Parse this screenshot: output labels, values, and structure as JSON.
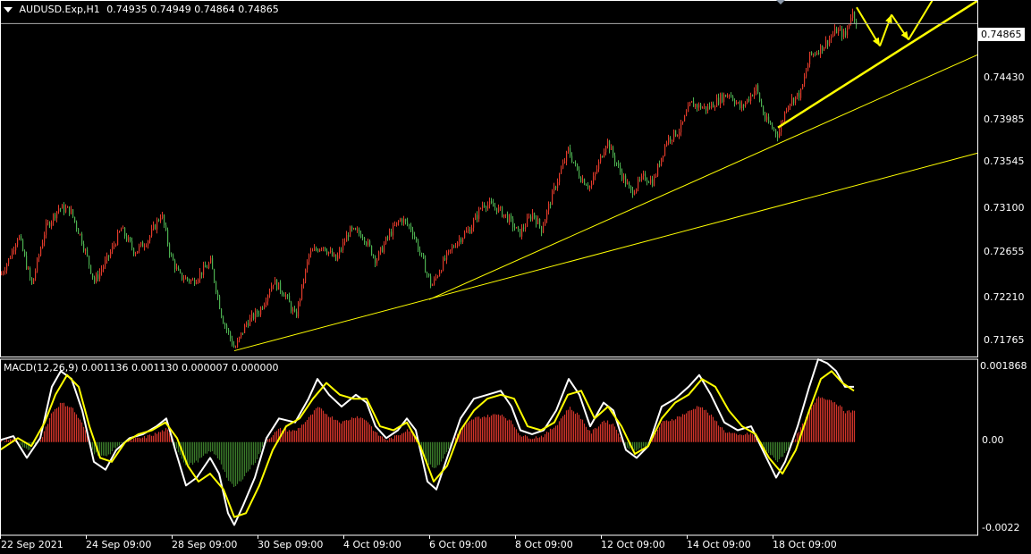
{
  "header": {
    "symbol_text": "AUDUSD.Exp,H1",
    "ohlc_text": "0.74935 0.74949 0.74864 0.74865",
    "menu_icon": "triangle-down-icon"
  },
  "colors": {
    "background": "#000000",
    "bull": "#e03a2a",
    "bear": "#4caf50",
    "trendline": "#ffff00",
    "macd_line": "#ffffff",
    "signal_line": "#ffff00",
    "hist_pos": "#d0342a",
    "hist_neg": "#3a7a2a",
    "grid_line": "#aaaaaa"
  },
  "chart_data": [
    {
      "type": "candlestick",
      "title": "AUDUSD.Exp,H1",
      "current_price_label": "0.74865",
      "ylim": [
        0.7168,
        0.7509
      ],
      "y_ticks": [
        "0.74430",
        "0.73985",
        "0.73545",
        "0.73100",
        "0.72655",
        "0.72210",
        "0.71765"
      ],
      "x_ticks": [
        "22 Sep 2021",
        "24 Sep 09:00",
        "28 Sep 09:00",
        "30 Sep 09:00",
        "4 Oct 09:00",
        "6 Oct 09:00",
        "8 Oct 09:00",
        "12 Oct 09:00",
        "14 Oct 09:00",
        "18 Oct 09:00"
      ],
      "close_path": [
        [
          0,
          0.7246
        ],
        [
          10,
          0.7262
        ],
        [
          20,
          0.7285
        ],
        [
          35,
          0.7236
        ],
        [
          50,
          0.729
        ],
        [
          65,
          0.731
        ],
        [
          78,
          0.7308
        ],
        [
          90,
          0.7282
        ],
        [
          105,
          0.724
        ],
        [
          120,
          0.7262
        ],
        [
          135,
          0.729
        ],
        [
          150,
          0.7268
        ],
        [
          165,
          0.728
        ],
        [
          180,
          0.7305
        ],
        [
          190,
          0.7265
        ],
        [
          200,
          0.7245
        ],
        [
          215,
          0.724
        ],
        [
          235,
          0.7258
        ],
        [
          248,
          0.7205
        ],
        [
          262,
          0.7175
        ],
        [
          275,
          0.72
        ],
        [
          290,
          0.7212
        ],
        [
          305,
          0.724
        ],
        [
          318,
          0.7228
        ],
        [
          330,
          0.7205
        ],
        [
          345,
          0.7265
        ],
        [
          360,
          0.7275
        ],
        [
          375,
          0.726
        ],
        [
          390,
          0.7288
        ],
        [
          405,
          0.7285
        ],
        [
          420,
          0.726
        ],
        [
          435,
          0.7285
        ],
        [
          448,
          0.73
        ],
        [
          460,
          0.729
        ],
        [
          470,
          0.7265
        ],
        [
          482,
          0.7235
        ],
        [
          495,
          0.7258
        ],
        [
          510,
          0.7278
        ],
        [
          525,
          0.729
        ],
        [
          540,
          0.7315
        ],
        [
          555,
          0.731
        ],
        [
          568,
          0.73
        ],
        [
          580,
          0.7285
        ],
        [
          595,
          0.7305
        ],
        [
          605,
          0.729
        ],
        [
          620,
          0.733
        ],
        [
          635,
          0.7365
        ],
        [
          648,
          0.734
        ],
        [
          660,
          0.733
        ],
        [
          678,
          0.7375
        ],
        [
          690,
          0.735
        ],
        [
          705,
          0.7325
        ],
        [
          720,
          0.734
        ],
        [
          730,
          0.7335
        ],
        [
          745,
          0.7375
        ],
        [
          760,
          0.7385
        ],
        [
          772,
          0.741
        ],
        [
          790,
          0.7405
        ],
        [
          805,
          0.7415
        ],
        [
          815,
          0.742
        ],
        [
          828,
          0.7405
        ],
        [
          845,
          0.7425
        ],
        [
          855,
          0.7395
        ],
        [
          870,
          0.738
        ],
        [
          880,
          0.741
        ],
        [
          895,
          0.742
        ],
        [
          905,
          0.7455
        ],
        [
          920,
          0.7465
        ],
        [
          935,
          0.748
        ],
        [
          945,
          0.7475
        ],
        [
          952,
          0.7498
        ],
        [
          958,
          0.7487
        ]
      ],
      "trendlines": [
        {
          "x1": 262,
          "y1": 0.71735,
          "x2": 1093,
          "y2": 0.73625,
          "width": 1
        },
        {
          "x1": 480,
          "y1": 0.72225,
          "x2": 1093,
          "y2": 0.74565,
          "width": 1
        },
        {
          "x1": 870,
          "y1": 0.7387,
          "x2": 1093,
          "y2": 0.75082,
          "width": 2.5
        }
      ],
      "projection_arrows": [
        {
          "x1": 958,
          "y1": 0.7502,
          "x2": 984,
          "y2": 0.7465
        },
        {
          "x1": 984,
          "y1": 0.7465,
          "x2": 997,
          "y2": 0.7495
        },
        {
          "x1": 997,
          "y1": 0.7495,
          "x2": 1016,
          "y2": 0.7471
        },
        {
          "x1": 1016,
          "y1": 0.7471,
          "x2": 1050,
          "y2": 0.7519
        }
      ]
    },
    {
      "type": "line",
      "title": "MACD(12,26,9) 0.001136 0.001130 0.000007 0.000000",
      "ylim": [
        -0.00236,
        0.0021
      ],
      "y_ticks": [
        "0.001868",
        "0.00",
        "-0.0022"
      ],
      "series": [
        {
          "name": "MACD",
          "points": [
            [
              0,
              5e-05
            ],
            [
              15,
              0.00015
            ],
            [
              30,
              -0.0004
            ],
            [
              45,
              0.0001
            ],
            [
              58,
              0.0014
            ],
            [
              68,
              0.0018
            ],
            [
              80,
              0.0016
            ],
            [
              92,
              0.0008
            ],
            [
              105,
              -0.0005
            ],
            [
              118,
              -0.0007
            ],
            [
              130,
              -0.0002
            ],
            [
              145,
              0.0001
            ],
            [
              160,
              0.0002
            ],
            [
              175,
              0.0004
            ],
            [
              186,
              0.0006
            ],
            [
              196,
              -0.0002
            ],
            [
              208,
              -0.0011
            ],
            [
              220,
              -0.0009
            ],
            [
              235,
              -0.0004
            ],
            [
              245,
              -0.0008
            ],
            [
              255,
              -0.0018
            ],
            [
              262,
              -0.0021
            ],
            [
              272,
              -0.0016
            ],
            [
              285,
              -0.0009
            ],
            [
              298,
              0.0001
            ],
            [
              312,
              0.0006
            ],
            [
              330,
              0.0005
            ],
            [
              345,
              0.0011
            ],
            [
              355,
              0.0016
            ],
            [
              368,
              0.0012
            ],
            [
              382,
              0.0009
            ],
            [
              398,
              0.0012
            ],
            [
              410,
              0.001
            ],
            [
              420,
              0.0004
            ],
            [
              432,
              0.0001
            ],
            [
              445,
              0.0003
            ],
            [
              455,
              0.0006
            ],
            [
              465,
              0.0003
            ],
            [
              478,
              -0.001
            ],
            [
              488,
              -0.0012
            ],
            [
              500,
              -0.0004
            ],
            [
              515,
              0.0006
            ],
            [
              530,
              0.0011
            ],
            [
              545,
              0.0012
            ],
            [
              560,
              0.0013
            ],
            [
              572,
              0.0009
            ],
            [
              582,
              0.0003
            ],
            [
              595,
              0.0002
            ],
            [
              608,
              0.0003
            ],
            [
              622,
              0.0008
            ],
            [
              636,
              0.0016
            ],
            [
              648,
              0.0012
            ],
            [
              660,
              0.0004
            ],
            [
              675,
              0.001
            ],
            [
              686,
              0.0008
            ],
            [
              700,
              -0.0002
            ],
            [
              712,
              -0.0004
            ],
            [
              725,
              -0.0001
            ],
            [
              740,
              0.0009
            ],
            [
              755,
              0.0011
            ],
            [
              770,
              0.0014
            ],
            [
              782,
              0.0017
            ],
            [
              795,
              0.0012
            ],
            [
              810,
              0.0005
            ],
            [
              825,
              0.0003
            ],
            [
              840,
              0.0004
            ],
            [
              855,
              -0.0003
            ],
            [
              868,
              -0.0009
            ],
            [
              878,
              -0.0005
            ],
            [
              892,
              0.0004
            ],
            [
              905,
              0.0014
            ],
            [
              915,
              0.0021
            ],
            [
              925,
              0.002
            ],
            [
              935,
              0.0018
            ],
            [
              945,
              0.0014
            ],
            [
              955,
              0.0014
            ]
          ]
        },
        {
          "name": "Signal",
          "points": [
            [
              0,
              -0.0002
            ],
            [
              20,
              0.0001
            ],
            [
              35,
              -0.0001
            ],
            [
              50,
              0.0005
            ],
            [
              62,
              0.0012
            ],
            [
              75,
              0.0017
            ],
            [
              88,
              0.0014
            ],
            [
              100,
              0.0004
            ],
            [
              112,
              -0.0004
            ],
            [
              125,
              -0.0005
            ],
            [
              140,
              0.0
            ],
            [
              155,
              0.0002
            ],
            [
              170,
              0.0003
            ],
            [
              185,
              0.0005
            ],
            [
              198,
              0.0001
            ],
            [
              210,
              -0.0006
            ],
            [
              222,
              -0.001
            ],
            [
              235,
              -0.0008
            ],
            [
              250,
              -0.0012
            ],
            [
              262,
              -0.0019
            ],
            [
              275,
              -0.0018
            ],
            [
              290,
              -0.0011
            ],
            [
              305,
              -0.0002
            ],
            [
              320,
              0.0004
            ],
            [
              335,
              0.0006
            ],
            [
              350,
              0.0011
            ],
            [
              365,
              0.0015
            ],
            [
              380,
              0.0012
            ],
            [
              395,
              0.0011
            ],
            [
              410,
              0.0011
            ],
            [
              425,
              0.0004
            ],
            [
              440,
              0.0003
            ],
            [
              455,
              0.0005
            ],
            [
              470,
              -0.0001
            ],
            [
              485,
              -0.001
            ],
            [
              500,
              -0.0006
            ],
            [
              515,
              0.0003
            ],
            [
              530,
              0.0008
            ],
            [
              545,
              0.0011
            ],
            [
              560,
              0.0012
            ],
            [
              575,
              0.0011
            ],
            [
              590,
              0.0004
            ],
            [
              605,
              0.0003
            ],
            [
              620,
              0.0005
            ],
            [
              635,
              0.0012
            ],
            [
              650,
              0.0013
            ],
            [
              665,
              0.0006
            ],
            [
              680,
              0.0009
            ],
            [
              695,
              0.0004
            ],
            [
              710,
              -0.0003
            ],
            [
              725,
              -0.0001
            ],
            [
              740,
              0.0006
            ],
            [
              755,
              0.001
            ],
            [
              770,
              0.0012
            ],
            [
              785,
              0.0016
            ],
            [
              800,
              0.0014
            ],
            [
              815,
              0.0008
            ],
            [
              830,
              0.0004
            ],
            [
              845,
              0.0002
            ],
            [
              860,
              -0.0004
            ],
            [
              875,
              -0.0008
            ],
            [
              890,
              -0.0002
            ],
            [
              905,
              0.0008
            ],
            [
              918,
              0.0016
            ],
            [
              930,
              0.0018
            ],
            [
              942,
              0.0015
            ],
            [
              955,
              0.0013
            ]
          ]
        }
      ]
    }
  ]
}
